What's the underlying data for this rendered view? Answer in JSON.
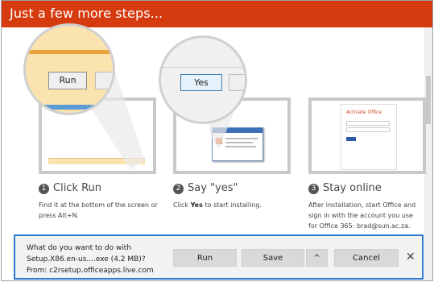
{
  "header": {
    "title": "Just a few more steps..."
  },
  "illustrations": {
    "zoom_run_label": "Run",
    "zoom_yes_label": "Yes",
    "activate_title": "Activate Office"
  },
  "steps": [
    {
      "number": "1",
      "title": "Click Run",
      "desc": "Find it at the bottom of the screen or press Alt+N."
    },
    {
      "number": "2",
      "title": "Say \"yes\"",
      "desc_bold": "Yes",
      "desc_pre": "Click ",
      "desc_post": " to start installing."
    },
    {
      "number": "3",
      "title": "Stay online",
      "desc": "After installation, start Office and sign in with the account you use for Office 365: brad@sun.ac.za."
    }
  ],
  "download_bar": {
    "line1": "What do you want to do with",
    "line2": "Setup.X86.en-us....exe (4.2 MB)?",
    "line3": "From: c2rsetup.officeapps.live.com",
    "run_label": "Run",
    "save_label": "Save",
    "chevron": "^",
    "cancel_label": "Cancel",
    "close_glyph": "✕"
  },
  "colors": {
    "header": "#d63b10",
    "focus_border": "#2b79d0"
  }
}
